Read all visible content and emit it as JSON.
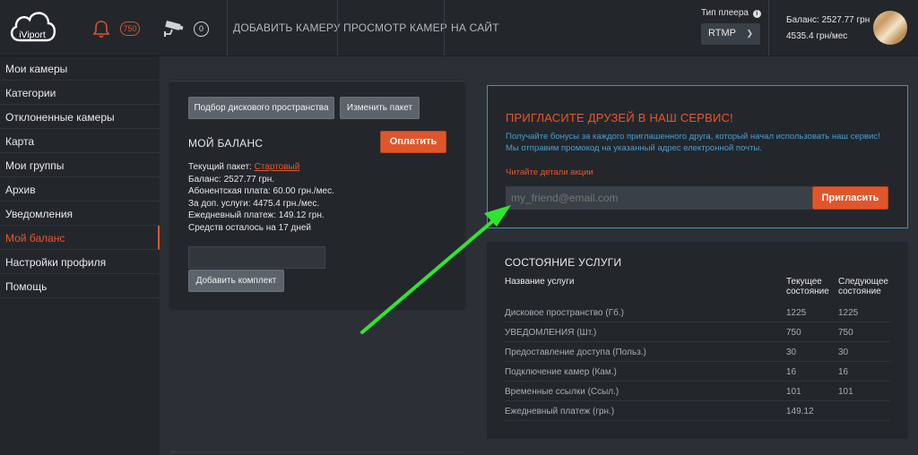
{
  "header": {
    "logo_text": "iViport",
    "notifications_count": "750",
    "cameras_count": "0",
    "nav": [
      "ДОБАВИТЬ КАМЕРУ",
      "ПРОСМОТР КАМЕР",
      "НА САЙТ"
    ],
    "player_type_label": "Тип плеера",
    "player_type_value": "RTMP",
    "balance_line": "Баланс: 2527.77 грн",
    "rate_line": "4535.4 грн/мес"
  },
  "sidebar": {
    "items": [
      {
        "label": "Мои камеры"
      },
      {
        "label": "Категории"
      },
      {
        "label": "Отклоненные камеры"
      },
      {
        "label": "Карта"
      },
      {
        "label": "Мои группы"
      },
      {
        "label": "Архив"
      },
      {
        "label": "Уведомления"
      },
      {
        "label": "Мой баланс"
      },
      {
        "label": "Настройки профиля"
      },
      {
        "label": "Помощь"
      }
    ]
  },
  "balance": {
    "disk_button": "Подбор дискового пространства",
    "change_button": "Изменить пакет",
    "title": "МОЙ БАЛАНС",
    "pay_button": "Оплатить",
    "package_label": "Текущий пакет:",
    "package_value": "Стартовый",
    "lines": [
      "Баланс: 2527.77 грн.",
      "Абонентская плата: 60.00 грн./мес.",
      "За доп. услуги: 4475.4 грн./мес.",
      "Ежедневный платеж: 149.12 грн.",
      "Средств осталось на 17 дней"
    ],
    "add_kit_button": "Добавить комплект"
  },
  "invite": {
    "title": "ПРИГЛАСИТЕ ДРУЗЕЙ В НАШ СЕРВИС!",
    "text1": "Получайте бонусы за каждого приглашенного друга, который начал использовать наш сервис!",
    "text2": "Мы отправим промокод на указанный адрес електронной почты.",
    "details_link": "Читайте детали акции",
    "email_placeholder": "my_friend@email.com",
    "invite_button": "Пригласить"
  },
  "status": {
    "title": "СОСТОЯНИЕ УСЛУГИ",
    "col_name": "Название услуги",
    "col_current_1": "Текущее",
    "col_current_2": "состояние",
    "col_next_1": "Следующее",
    "col_next_2": "состояние",
    "rows": [
      {
        "name": "Дисковое пространство (Гб.)",
        "current": "1225",
        "next": "1225"
      },
      {
        "name": "УВЕДОМЛЕНИЯ (Шт.)",
        "current": "750",
        "next": "750"
      },
      {
        "name": "Предоставление доступа (Польз.)",
        "current": "30",
        "next": "30"
      },
      {
        "name": "Подключение камер (Кам.)",
        "current": "16",
        "next": "16"
      },
      {
        "name": "Временные ссылки (Ссыл.)",
        "current": "101",
        "next": "101"
      },
      {
        "name": "Ежедневный платеж (грн.)",
        "current": "149.12",
        "next": ""
      }
    ]
  },
  "colors": {
    "accent_orange": "#e0562b",
    "link_blue": "#4a9fd0",
    "arrow_green": "#2fe62f",
    "background": "#2b3036",
    "panel": "#23272c"
  }
}
